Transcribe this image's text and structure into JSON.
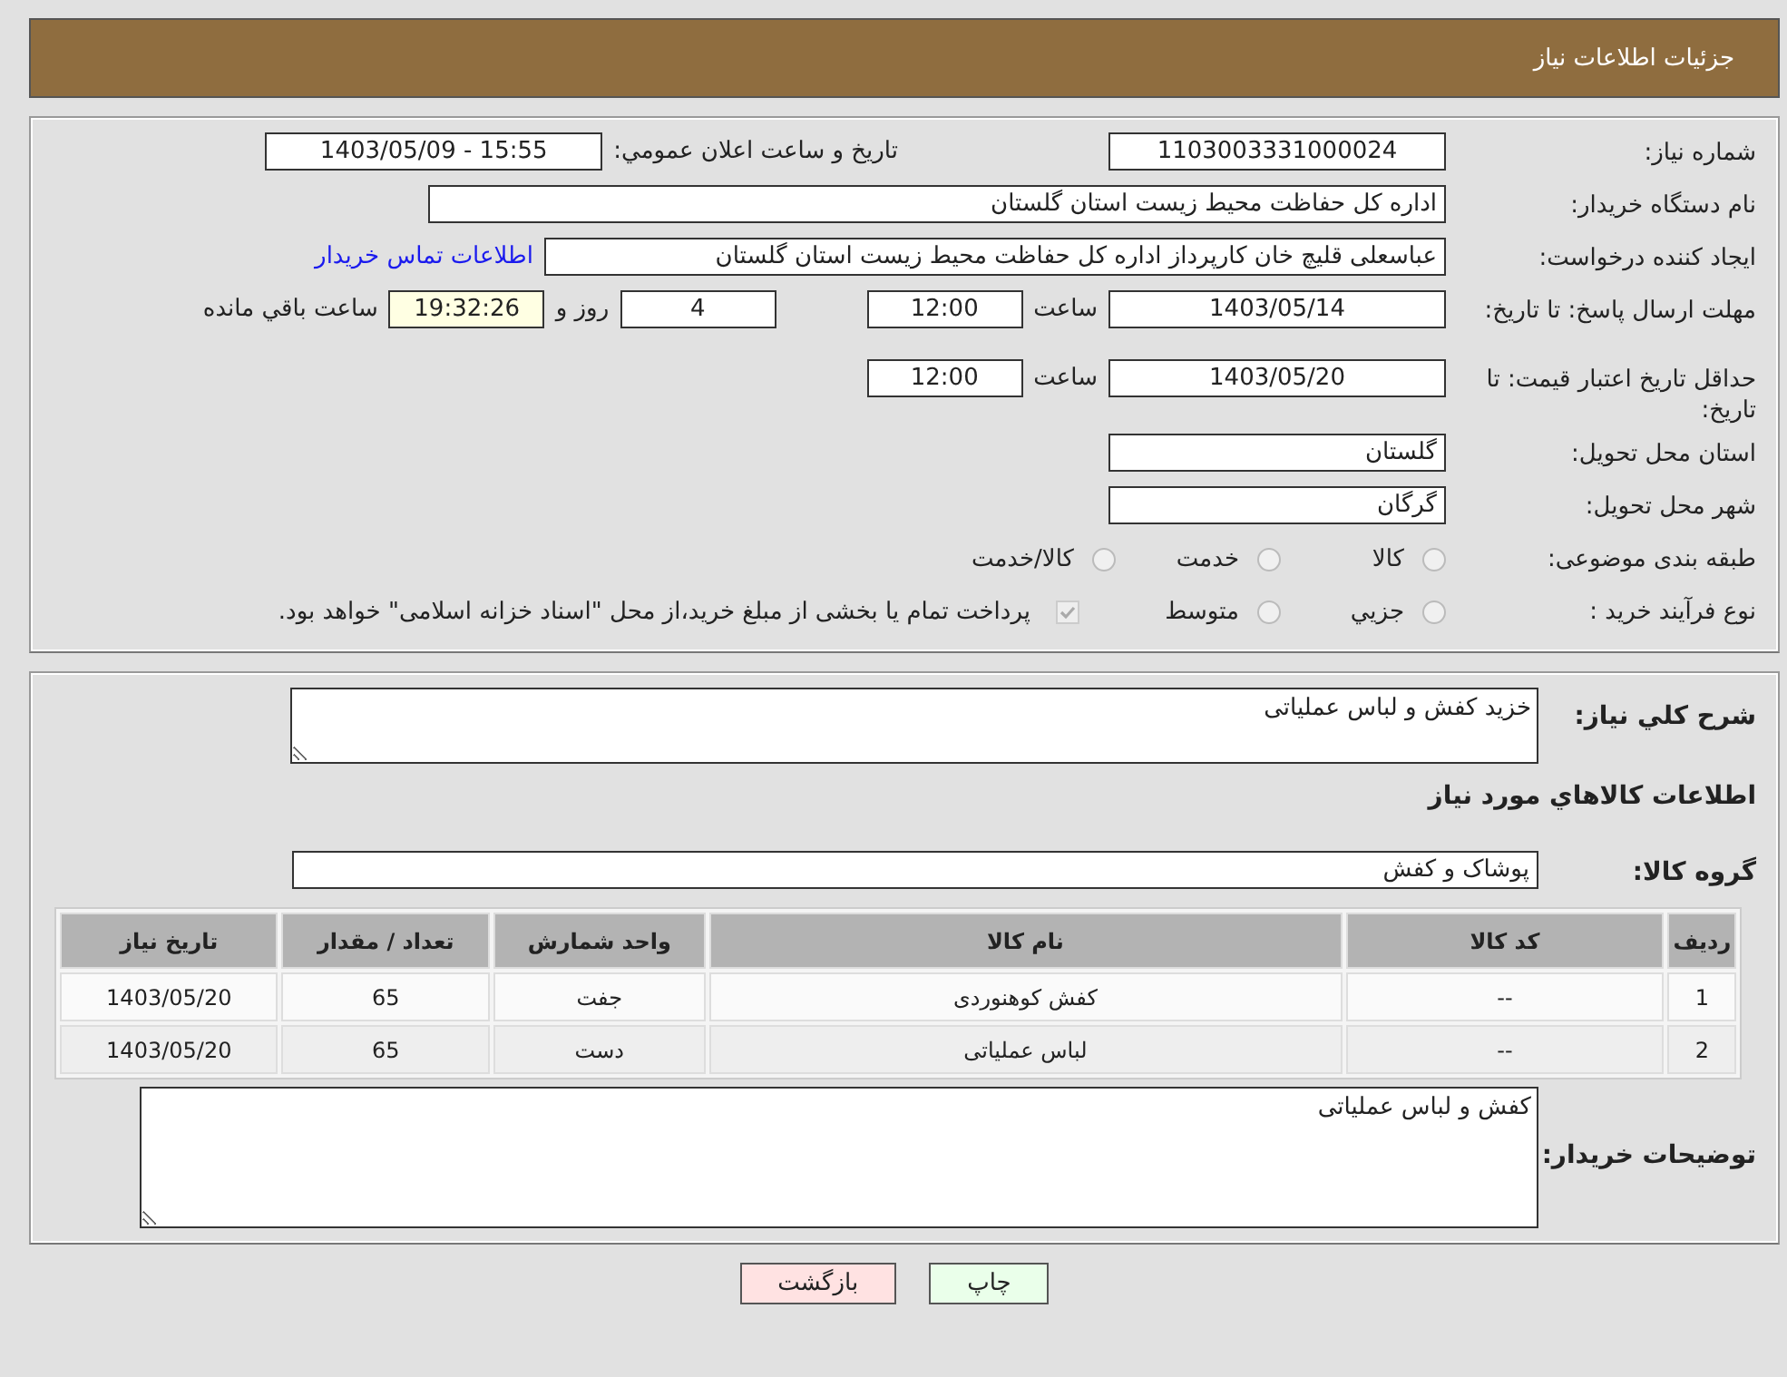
{
  "header": {
    "title": "جزئیات اطلاعات نیاز"
  },
  "details": {
    "need_number": {
      "label": "شماره نیاز:",
      "value": "1103003331000024"
    },
    "announce": {
      "label": "تاریخ و ساعت اعلان عمومي:",
      "value": "1403/05/09 - 15:55"
    },
    "buyer": {
      "label": "نام دستگاه خریدار:",
      "value": "اداره کل حفاظت محیط زیست استان گلستان"
    },
    "requester": {
      "label": "ایجاد کننده درخواست:",
      "value": "عباسعلی  قلیچ خان  کارپرداز اداره کل حفاظت محیط زیست استان گلستان",
      "link": "اطلاعات تماس خریدار"
    },
    "deadline": {
      "label": "مهلت ارسال پاسخ: تا تاریخ:",
      "date": "1403/05/14",
      "time_label": "ساعت",
      "time": "12:00",
      "days": "4",
      "days_label": "روز و",
      "remaining": "19:32:26",
      "remaining_label": "ساعت باقي مانده"
    },
    "validity": {
      "label": "حداقل تاریخ اعتبار قیمت: تا تاریخ:",
      "date": "1403/05/20",
      "time_label": "ساعت",
      "time": "12:00"
    },
    "province": {
      "label": "استان محل تحویل:",
      "value": "گلستان"
    },
    "city": {
      "label": "شهر محل تحویل:",
      "value": "گرگان"
    },
    "category": {
      "label": "طبقه بندی موضوعی:",
      "options": [
        {
          "label": "کالا",
          "selected": false
        },
        {
          "label": "خدمت",
          "selected": false
        },
        {
          "label": "کالا/خدمت",
          "selected": false
        }
      ]
    },
    "process": {
      "label": "نوع فرآیند خرید :",
      "options": [
        {
          "label": "جزيي",
          "selected": false
        },
        {
          "label": "متوسط",
          "selected": false
        }
      ],
      "payment": {
        "checked": true,
        "disabled": true,
        "text": "پرداخت تمام یا بخشی از مبلغ خرید،از محل \"اسناد خزانه اسلامی\" خواهد بود."
      }
    }
  },
  "items": {
    "summary": {
      "label": "شرح كلي نیاز:",
      "value": "خزید کفش و لباس عملیاتی"
    },
    "heading": "اطلاعات كالاهاي مورد نیاز",
    "group": {
      "label": "گروه کالا:",
      "value": "پوشاک و کفش"
    },
    "table": {
      "columns": [
        "رديف",
        "کد کالا",
        "نام کالا",
        "واحد شمارش",
        "تعداد / مقدار",
        "تاریخ نیاز"
      ],
      "rows": [
        [
          "1",
          "--",
          "کفش کوهنوردی",
          "جفت",
          "65",
          "1403/05/20"
        ],
        [
          "2",
          "--",
          "لباس عملیاتی",
          "دست",
          "65",
          "1403/05/20"
        ]
      ]
    },
    "notes": {
      "label": "توضیحات خریدار:",
      "value": "کفش و لباس عملیاتی"
    }
  },
  "buttons": [
    {
      "label": "چاپ",
      "kind": "print"
    },
    {
      "label": "بازگشت",
      "kind": "back"
    }
  ]
}
